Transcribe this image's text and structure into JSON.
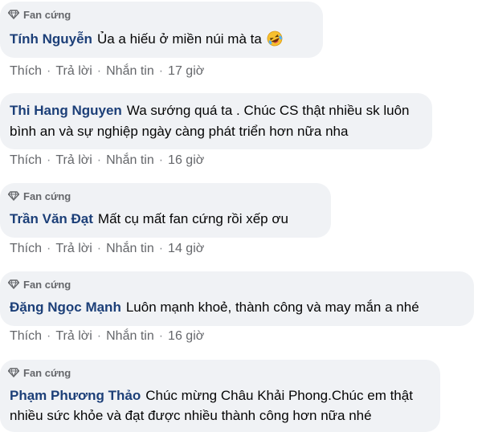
{
  "badge_label": "Fan cứng",
  "actions": {
    "like": "Thích",
    "reply": "Trả lời",
    "message": "Nhắn tin",
    "separator": "·"
  },
  "comments": [
    {
      "author": "Tính Nguyễn",
      "has_badge": true,
      "lines": [
        "Ủa a hiếu ở miền núi mà ta"
      ],
      "emoji": "rolling-laughing-emoji",
      "time": "17 giờ"
    },
    {
      "author": "Thi Hang Nguyen",
      "has_badge": false,
      "lines": [
        "Wa sướng quá ta . Chúc CS thật nhiều sk luôn",
        "bình an và sự nghiệp ngày càng phát triển hơn nữa nha"
      ],
      "time": "16 giờ"
    },
    {
      "author": "Trần Văn Đạt",
      "has_badge": true,
      "lines": [
        "Mất cụ mất fan cứng rồi xếp ơu"
      ],
      "time": "14 giờ"
    },
    {
      "author": "Đặng Ngọc Mạnh",
      "has_badge": true,
      "lines": [
        "Luôn mạnh khoẻ, thành công và may mắn a nhé"
      ],
      "time": "16 giờ"
    },
    {
      "author": "Phạm Phương Thảo",
      "has_badge": true,
      "lines": [
        "Chúc mừng Châu Khải Phong.Chúc em thật",
        "nhiều sức khỏe và đạt được nhiều thành công hơn nữa nhé"
      ]
    }
  ]
}
